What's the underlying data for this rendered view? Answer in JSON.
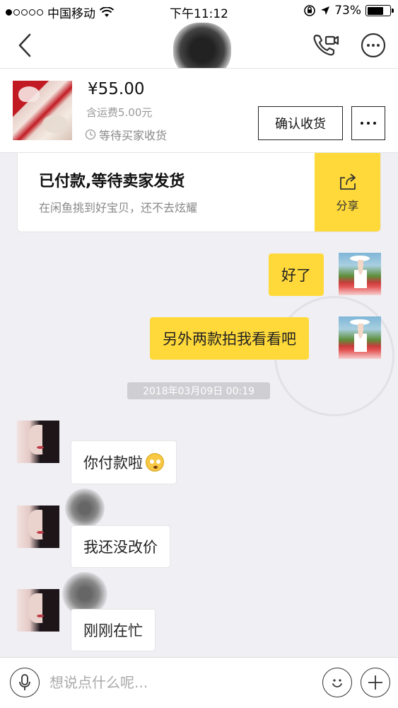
{
  "status_bar": {
    "carrier": "中国移动",
    "time": "下午11:12",
    "battery": "73%",
    "battery_level": 0.73,
    "signal_bars": 1
  },
  "header": {
    "back_icon": "chevron-left-icon",
    "call_icon": "phone-video-icon",
    "more_icon": "more-circle-icon"
  },
  "order": {
    "price": "¥55.00",
    "shipping": "含运费5.00元",
    "status": "等待买家收货",
    "confirm_label": "确认收货",
    "more_icon": "ellipsis-icon"
  },
  "notice": {
    "title": "已付款,等待卖家发货",
    "subtitle": "在闲鱼挑到好宝贝，还不去炫耀",
    "share_label": "分享",
    "share_icon": "share-icon"
  },
  "messages": [
    {
      "side": "right",
      "text": "好了"
    },
    {
      "side": "right",
      "text": "另外两款拍我看看吧"
    },
    {
      "side": "left",
      "text": "你付款啦"
    },
    {
      "side": "left",
      "text": "我还没改价"
    },
    {
      "side": "left",
      "text": "刚刚在忙"
    }
  ],
  "timestamp": "2018年03月09日 00:19",
  "input": {
    "placeholder": "想说点什么呢...",
    "mic_icon": "microphone-icon",
    "emoji_icon": "smiley-icon",
    "plus_icon": "plus-icon"
  },
  "colors": {
    "accent": "#ffd93a",
    "background": "#efeff4"
  }
}
